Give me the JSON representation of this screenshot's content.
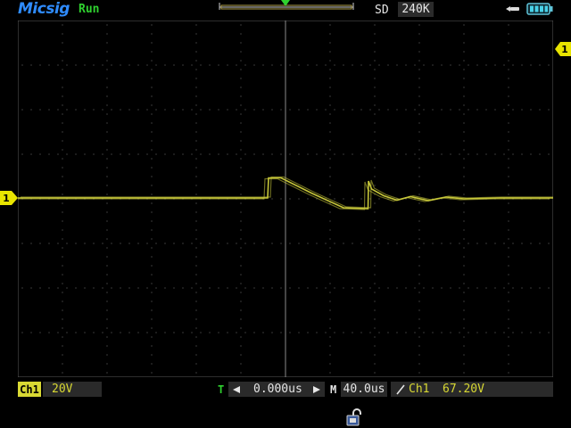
{
  "header": {
    "brand": "Micsig",
    "run_status": "Run",
    "sd_label": "SD",
    "memory_depth": "240K",
    "icons": [
      "timebase-overview-icon",
      "usb-icon",
      "battery-icon"
    ]
  },
  "markers": {
    "ch1_ref": "1",
    "trigger_level": "1",
    "trigger_position": "T"
  },
  "footer": {
    "channel_badge": "Ch1",
    "channel_scale": "20V",
    "time_label": "T",
    "time_offset": "0.000us",
    "timebase_label": "M",
    "timebase_value": "40.0us",
    "trigger_source": "Ch1",
    "trigger_level": "67.20V",
    "icons": [
      "arrow-left-icon",
      "arrow-right-icon",
      "rising-edge-icon",
      "lock-icon"
    ]
  },
  "colors": {
    "brand": "#2f8cff",
    "run": "#2fd12f",
    "trace": "#c8c83a",
    "trigger": "#2fd12f",
    "channel": "#d8d833",
    "grid": "#6e6e6e"
  },
  "trace": {
    "points": [
      [
        0,
        0.0
      ],
      [
        5.6,
        0.0
      ],
      [
        5.62,
        0.45
      ],
      [
        5.9,
        0.45
      ],
      [
        6.6,
        0.1
      ],
      [
        7.3,
        -0.22
      ],
      [
        7.85,
        -0.24
      ],
      [
        7.86,
        0.38
      ],
      [
        7.93,
        0.2
      ],
      [
        8.2,
        0.05
      ],
      [
        8.5,
        -0.05
      ],
      [
        8.8,
        0.03
      ],
      [
        9.2,
        -0.06
      ],
      [
        9.6,
        0.02
      ],
      [
        10.0,
        -0.02
      ],
      [
        10.8,
        0.0
      ],
      [
        12.0,
        0.0
      ]
    ]
  }
}
